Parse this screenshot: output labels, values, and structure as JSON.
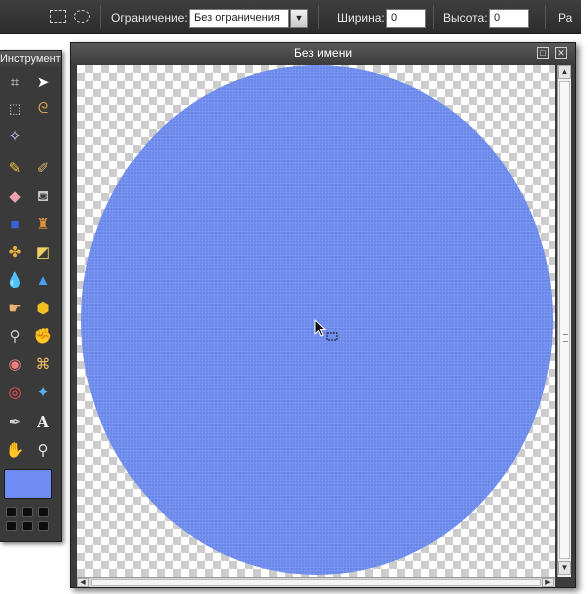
{
  "optbar": {
    "constraint_label": "Ограничение:",
    "constraint_value": "Без ограничения",
    "width_label": "Ширина:",
    "width_value": "0",
    "height_label": "Высота:",
    "height_value": "0",
    "right_truncated_label": "Ра"
  },
  "tools_panel": {
    "title": "Инструменты",
    "foreground_color": "#6f8cf4",
    "icons": [
      "crop-icon",
      "move-icon",
      "marquee-select-icon",
      "lasso-icon",
      "magic-wand-icon",
      "pencil-icon",
      "brush-icon",
      "eraser-icon",
      "paint-bucket-icon",
      "gradient-icon",
      "clone-stamp-icon",
      "color-replace-icon",
      "shape-icon",
      "drop-icon",
      "sharpen-icon",
      "smudge-icon",
      "sponge-icon",
      "dodge-icon",
      "burn-icon",
      "bandage-icon",
      "red-eye-icon",
      "pinch-icon",
      "picker-icon",
      "text-icon",
      "hand-icon",
      "zoom-icon"
    ]
  },
  "image_window": {
    "title": "Без имени",
    "fill_color": "#6e8cee"
  }
}
